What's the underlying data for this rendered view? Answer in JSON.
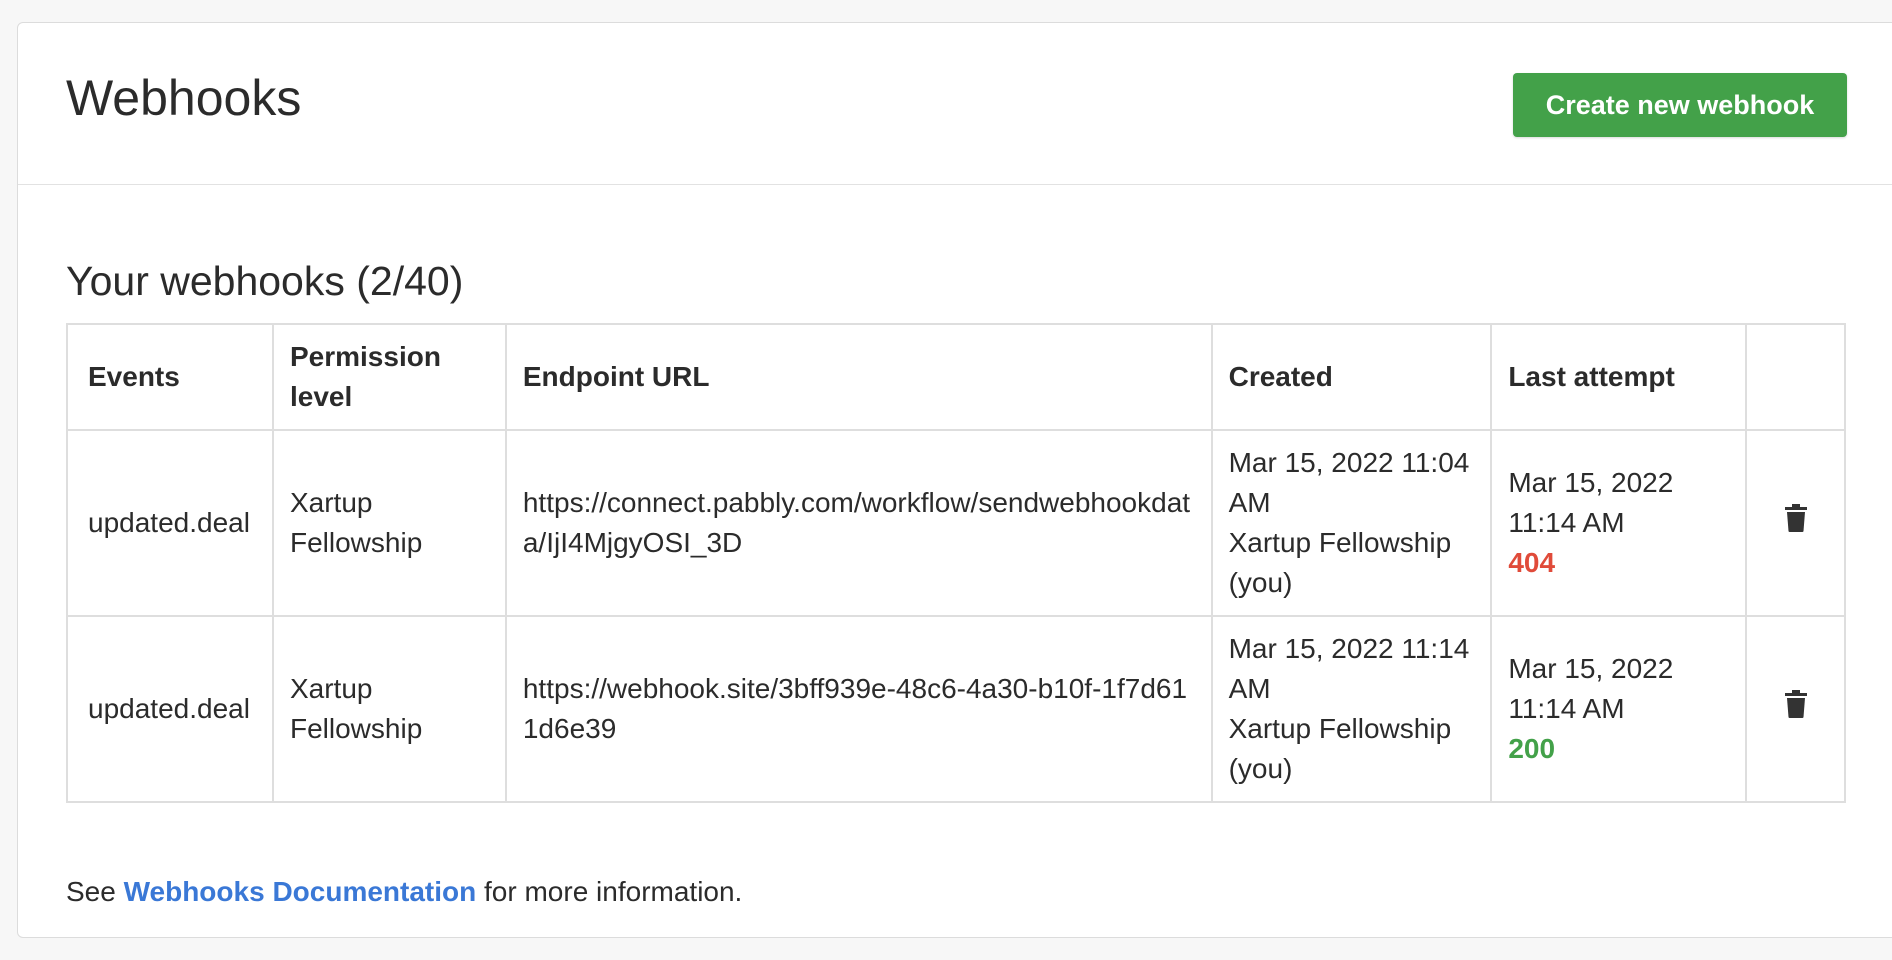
{
  "header": {
    "title": "Webhooks",
    "create_button_label": "Create new webhook"
  },
  "section": {
    "title": "Your webhooks (2/40)"
  },
  "table": {
    "columns": [
      "Events",
      "Permission level",
      "Endpoint URL",
      "Created",
      "Last attempt",
      ""
    ],
    "rows": [
      {
        "event": "updated.deal",
        "permission": "Xartup Fellowship",
        "url": "https://connect.pabbly.com/workflow/sendwebhookdata/IjI4MjgyOSI_3D",
        "created_date": "Mar 15, 2022 11:04 AM",
        "created_by": "Xartup Fellowship (you)",
        "last_attempt_date": "Mar 15, 2022 11:14 AM",
        "last_attempt_status": "404",
        "delete_icon": "trash-icon"
      },
      {
        "event": "updated.deal",
        "permission": "Xartup Fellowship",
        "url": "https://webhook.site/3bff939e-48c6-4a30-b10f-1f7d611d6e39",
        "created_date": "Mar 15, 2022 11:14 AM",
        "created_by": "Xartup Fellowship (you)",
        "last_attempt_date": "Mar 15, 2022 11:14 AM",
        "last_attempt_status": "200",
        "delete_icon": "trash-icon"
      }
    ]
  },
  "footer": {
    "prefix": "See",
    "link_label": "Webhooks Documentation",
    "suffix": "for more information."
  },
  "colors": {
    "primary_button": "#43a149",
    "status_error": "#e04b3a",
    "status_success": "#43a149",
    "link": "#3a78d6"
  }
}
